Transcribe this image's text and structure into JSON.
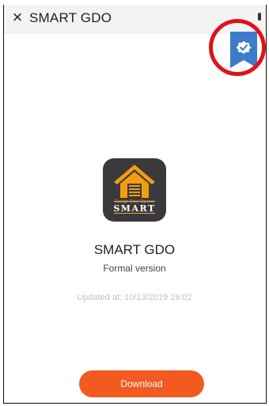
{
  "header": {
    "close_icon": "close-icon",
    "title": "SMART GDO"
  },
  "badge": {
    "icon": "verified-ribbon-icon",
    "color": "#3d7cc9",
    "highlight_color": "#e0121b"
  },
  "app": {
    "icon_small_text": "Garage Door Opener",
    "icon_brand_text": "SMART",
    "name": "SMART GDO",
    "version": "Formal version",
    "updated": "Updated at: 10/13/2019 16:02"
  },
  "actions": {
    "download_label": "Download",
    "download_color": "#f25a1f"
  }
}
